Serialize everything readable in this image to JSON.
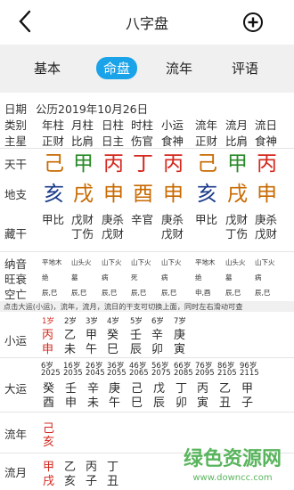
{
  "header": {
    "title": "八字盘"
  },
  "tabs": [
    "基本",
    "命盘",
    "流年",
    "评语"
  ],
  "date": {
    "label": "日期",
    "value": "公历2019年10月26日"
  },
  "categories": {
    "label": "类别",
    "values": [
      "年柱",
      "月柱",
      "日柱",
      "时柱",
      "小运",
      "流年",
      "流月",
      "流日"
    ]
  },
  "main_star": {
    "label": "主星",
    "values": [
      "正财",
      "比肩",
      "日主",
      "伤官",
      "食神",
      "正财",
      "比肩",
      "食神"
    ]
  },
  "tiangan": {
    "label": "天干",
    "values": [
      "己",
      "甲",
      "丙",
      "丁",
      "丙",
      "己",
      "甲",
      "丙"
    ]
  },
  "dizhi": {
    "label": "地支",
    "values": [
      "亥",
      "戌",
      "申",
      "酉",
      "申",
      "亥",
      "戌",
      "申"
    ]
  },
  "canggan": {
    "label": "藏干",
    "lines": [
      [
        "甲比",
        "戊财",
        "庚杀",
        "辛官",
        "庚杀",
        "甲比",
        "戊财",
        "庚杀"
      ],
      [
        "",
        "丁伤",
        "戊财",
        "",
        "戊财",
        "",
        "丁伤",
        "戊财"
      ]
    ]
  },
  "nayin": {
    "label": "纳音",
    "values": [
      "平地木",
      "山头火",
      "山下火",
      "山下火",
      "山下火",
      "平地木",
      "山头火",
      "山下火"
    ]
  },
  "wangshuai": {
    "label": "旺衰",
    "values": [
      "绝",
      "墓",
      "病",
      "死",
      "病",
      "绝",
      "墓",
      "病"
    ]
  },
  "kongwang": {
    "label": "空亡",
    "values": [
      "辰,巳",
      "辰,巳",
      "辰,巳",
      "辰,巳",
      "辰,巳",
      "申,酉",
      "辰,巳",
      "辰,巳"
    ]
  },
  "hint": "点击大运(小运)，流年，流月，流日的干支可切换上面，同时左右滑动可查",
  "xiaoyun": {
    "label": "小运",
    "ages": [
      "1岁",
      "2岁",
      "3岁",
      "4岁",
      "5岁",
      "6岁",
      "7岁"
    ],
    "gan": [
      "丙",
      "乙",
      "甲",
      "癸",
      "壬",
      "辛",
      "庚"
    ],
    "zhi": [
      "申",
      "未",
      "午",
      "巳",
      "辰",
      "卯",
      "寅"
    ]
  },
  "dayun": {
    "label": "大运",
    "ages": [
      "6岁",
      "16岁",
      "26岁",
      "36岁",
      "46岁",
      "56岁",
      "66岁",
      "76岁",
      "86岁",
      "96岁"
    ],
    "years": [
      "2025",
      "2035",
      "2045",
      "2055",
      "2065",
      "2075",
      "2085",
      "2095",
      "2105",
      "2115"
    ],
    "gan": [
      "癸",
      "壬",
      "辛",
      "庚",
      "己",
      "戊",
      "丁",
      "丙",
      "乙",
      "甲"
    ],
    "zhi": [
      "酉",
      "申",
      "未",
      "午",
      "巳",
      "辰",
      "卯",
      "寅",
      "丑",
      "子"
    ]
  },
  "liunian": {
    "label": "流年",
    "gan": "己",
    "zhi": "亥"
  },
  "liuyue": {
    "label": "流月",
    "gan": [
      "甲",
      "乙",
      "丙",
      "丁"
    ],
    "zhi": [
      "戌",
      "亥",
      "子",
      "丑"
    ]
  },
  "watermark": {
    "line1": "绿色资源网",
    "line2": "www.downcc.com"
  },
  "colors": {
    "tab_active": "#1aa3e8",
    "fire": "#d4281e",
    "wood": "#2a8a2a",
    "water": "#1a3a8a",
    "earth": "#c86a00"
  }
}
